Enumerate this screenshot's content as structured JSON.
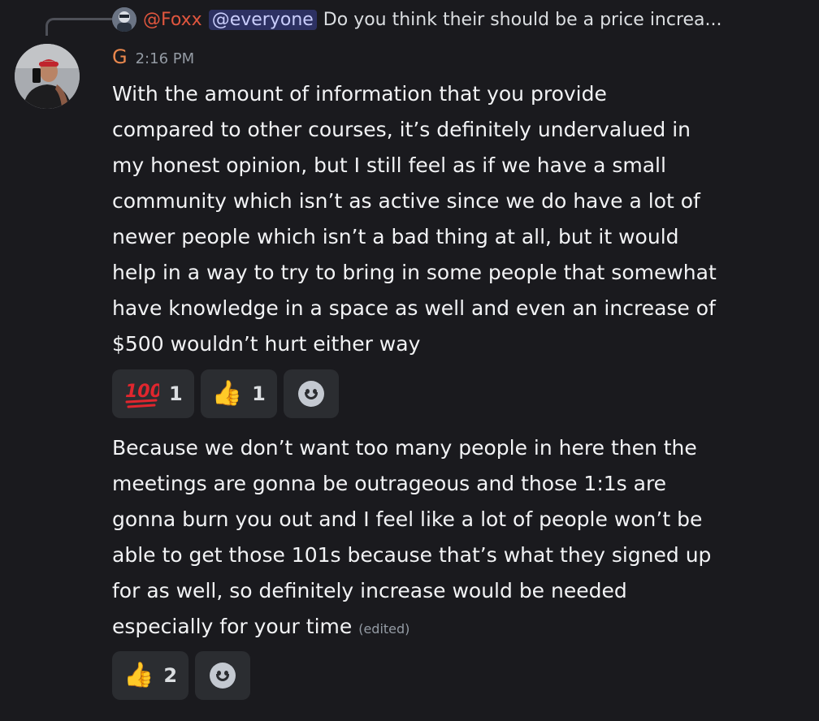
{
  "reply": {
    "author": "@Foxx",
    "mention": "@everyone",
    "preview": "Do you think their should be a price increa..."
  },
  "message": {
    "author": "G",
    "timestamp": "2:16 PM",
    "text1": "With the amount of information that you provide\ncompared to other courses, it’s definitely undervalued in\nmy honest opinion, but I still feel as if we have a small\ncommunity which isn’t as active since we do have a lot of\nnewer people which isn’t a bad thing at all, but it would\nhelp in a way to try to bring in some people that somewhat\nhave knowledge in a space as well and even an increase of\n$500 wouldn’t hurt either way",
    "text2": "Because we don’t want too many people in here then the\nmeetings are gonna be outrageous and those 1:1s are\ngonna burn you out and I feel like a lot of people won’t be\nable to get those 101s because that’s what they signed up\nfor as well, so definitely increase would be needed\nespecially for your time",
    "edited_label": "(edited)"
  },
  "reactions1": [
    {
      "emoji": "100",
      "count": "1"
    },
    {
      "emoji": "👍",
      "count": "1"
    }
  ],
  "reactions2": [
    {
      "emoji": "👍",
      "count": "2"
    }
  ],
  "icons": {
    "add_reaction": "smiley-face-icon"
  },
  "colors": {
    "background": "#1a1a1e",
    "reaction_bg": "#2b2d31",
    "username": "#e9874d",
    "reply_name": "#e0563e",
    "mention_bg": "#3b3f7a"
  }
}
